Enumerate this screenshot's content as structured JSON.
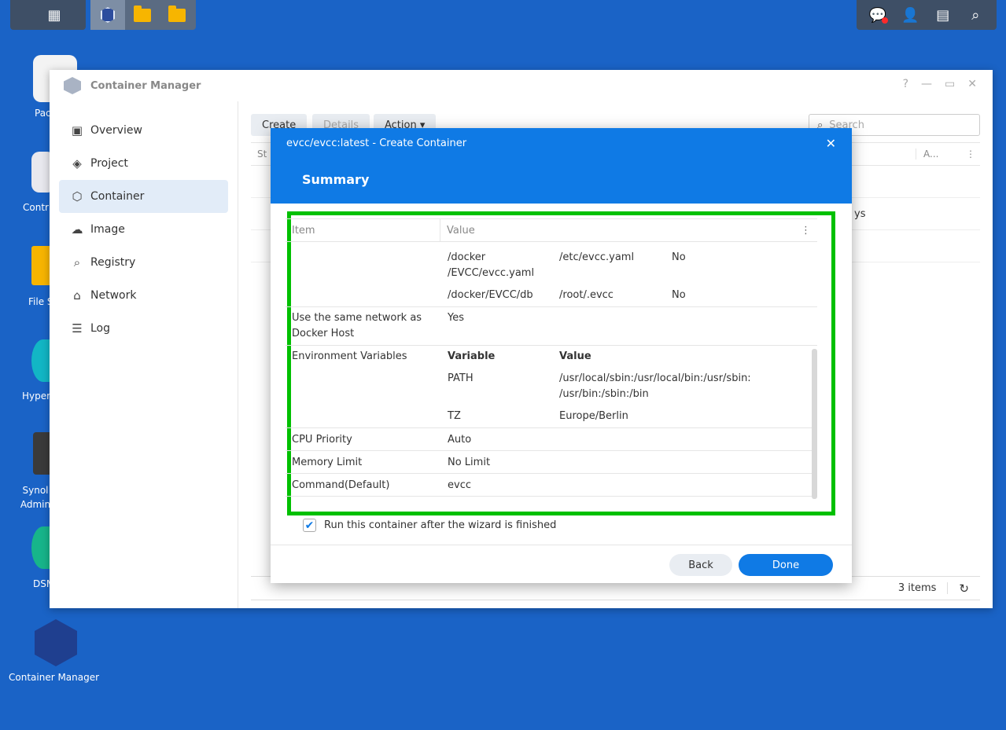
{
  "desktop": {
    "icons": [
      {
        "label": "Pac Ce"
      },
      {
        "label": "Contr"
      },
      {
        "label": "File S"
      },
      {
        "label": "Hyper"
      },
      {
        "label": "Synol Admin"
      },
      {
        "label": "DSM"
      },
      {
        "label": "Container Manager"
      }
    ]
  },
  "window": {
    "title": "Container Manager",
    "controls": {
      "help": "?",
      "minimize": "—",
      "maximize": "▭",
      "close": "✕"
    }
  },
  "sidebar": {
    "items": [
      {
        "label": "Overview",
        "icon": "overview-icon"
      },
      {
        "label": "Project",
        "icon": "layers-icon"
      },
      {
        "label": "Container",
        "icon": "cube-icon"
      },
      {
        "label": "Image",
        "icon": "cloud-icon"
      },
      {
        "label": "Registry",
        "icon": "registry-icon"
      },
      {
        "label": "Network",
        "icon": "home-network-icon"
      },
      {
        "label": "Log",
        "icon": "list-icon"
      }
    ]
  },
  "toolbar": {
    "create": "Create",
    "details": "Details",
    "action": "Action ▾",
    "search_placeholder": "Search"
  },
  "list": {
    "header_first": "St",
    "header_last": "A...",
    "row_fragment": "ys",
    "count": "3 items"
  },
  "dialog": {
    "title": "evcc/evcc:latest - Create Container",
    "close": "✕",
    "step": "Summary",
    "table": {
      "headers": {
        "item": "Item",
        "value": "Value"
      },
      "volumes": [
        {
          "host": "/docker\n/EVCC/evcc.yaml",
          "host_l1": "/docker",
          "host_l2": "/EVCC/evcc.yaml",
          "mount": "/etc/evcc.yaml",
          "readonly": "No"
        },
        {
          "host_l1": "/docker/EVCC/db",
          "mount": "/root/.evcc",
          "readonly": "No"
        }
      ],
      "network": {
        "item_l1": "Use the same network as",
        "item_l2": "Docker Host",
        "value": "Yes"
      },
      "env": {
        "item": "Environment Variables",
        "col_variable": "Variable",
        "col_value": "Value",
        "vars": [
          {
            "name": "PATH",
            "value_l1": "/usr/local/sbin:/usr/local/bin:/usr/sbin:",
            "value_l2": "/usr/bin:/sbin:/bin"
          },
          {
            "name": "TZ",
            "value_l1": "Europe/Berlin"
          }
        ]
      },
      "cpu": {
        "item": "CPU Priority",
        "value": "Auto"
      },
      "memory": {
        "item": "Memory Limit",
        "value": "No Limit"
      },
      "command": {
        "item": "Command(Default)",
        "value": "evcc"
      }
    },
    "run_after": "Run this container after the wizard is finished",
    "run_after_checked": true,
    "back": "Back",
    "done": "Done"
  }
}
